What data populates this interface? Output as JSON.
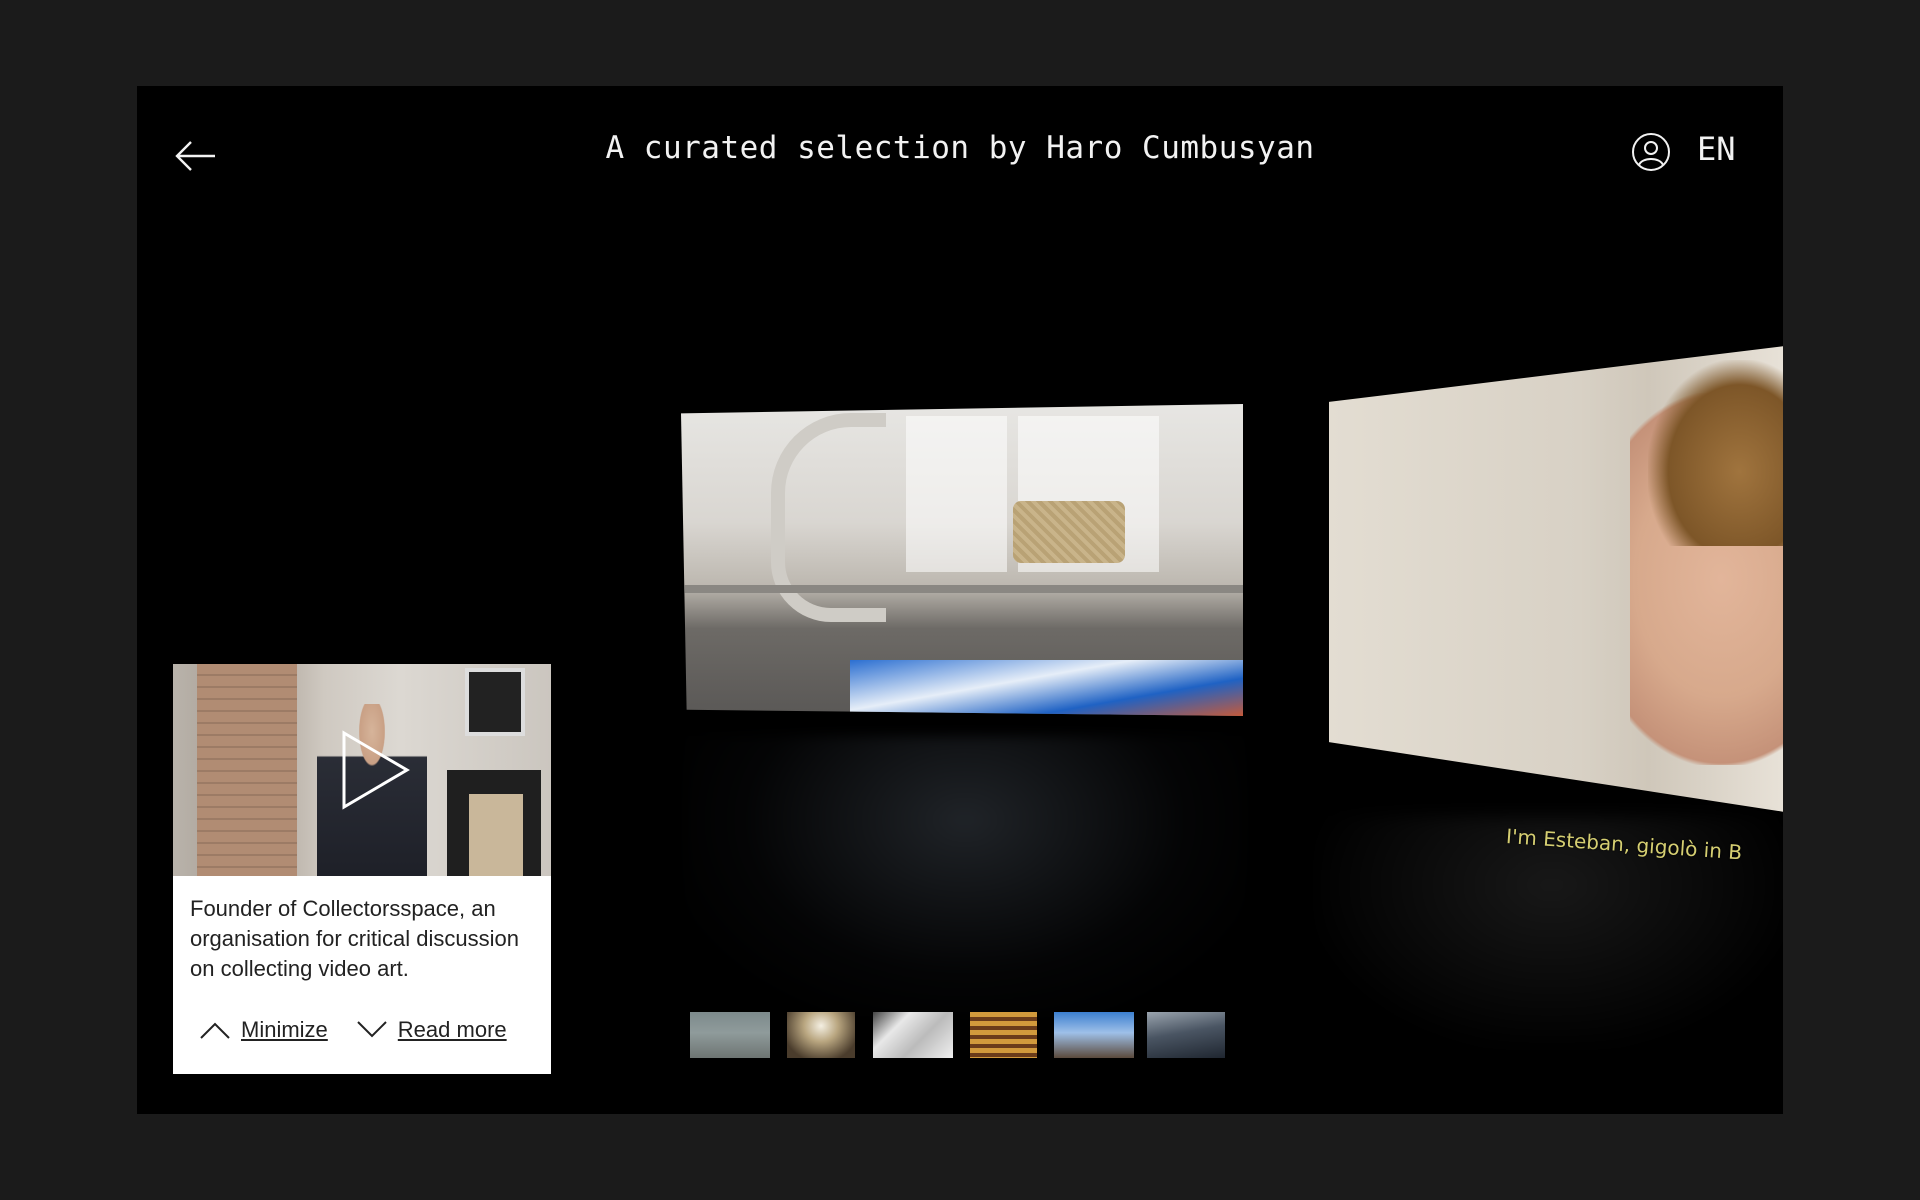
{
  "header": {
    "title": "A curated selection by Haro Cumbusyan",
    "language": "EN"
  },
  "icons": {
    "back": "arrow-left-icon",
    "user": "user-circle-icon",
    "play": "play-icon",
    "minimize": "chevron-up-icon",
    "read_more": "chevron-down-icon"
  },
  "stage": {
    "right_video_subtitle": "I'm Esteban, gigolò in B"
  },
  "thumbnails": [
    {
      "name": "runner"
    },
    {
      "name": "corridor"
    },
    {
      "name": "architecture-model"
    },
    {
      "name": "opera-house"
    },
    {
      "name": "street-sky"
    },
    {
      "name": "water"
    }
  ],
  "curator_card": {
    "description": "Founder of Collectorsspace, an organisation for critical discussion on collecting video art.",
    "minimize_label": "Minimize",
    "read_more_label": "Read more"
  },
  "colors": {
    "page_bg": "#1b1b1b",
    "stage_bg": "#000000",
    "text_light": "#f2f2f2",
    "subtitle_yellow": "#d6cf72"
  }
}
